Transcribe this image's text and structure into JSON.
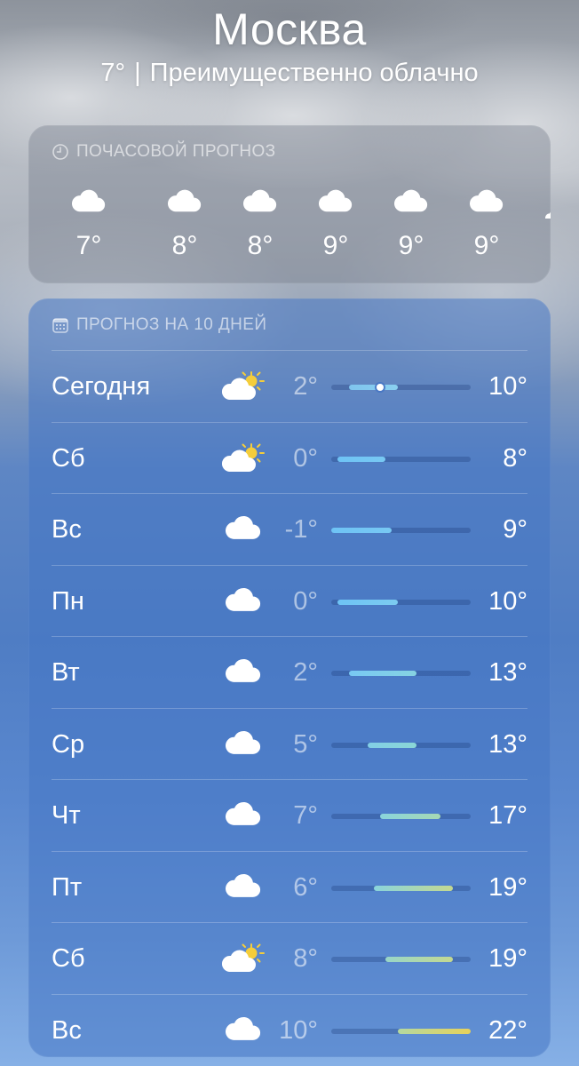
{
  "header": {
    "city": "Москва",
    "current_temp": "7°",
    "separator": "|",
    "condition": "Преимущественно облачно"
  },
  "hourly": {
    "title": "ПОЧАСОВОЙ ПРОГНОЗ",
    "icon": "clock-icon",
    "items": [
      {
        "icon": "cloud-icon",
        "temp": "7°"
      },
      {
        "icon": "cloud-icon",
        "temp": "8°"
      },
      {
        "icon": "cloud-icon",
        "temp": "8°"
      },
      {
        "icon": "cloud-icon",
        "temp": "9°"
      },
      {
        "icon": "cloud-icon",
        "temp": "9°"
      },
      {
        "icon": "cloud-icon",
        "temp": "9°"
      }
    ]
  },
  "daily": {
    "title": "ПРОГНОЗ НА 10 ДНЕЙ",
    "icon": "calendar-icon",
    "range": {
      "min": -1,
      "max": 22
    },
    "days": [
      {
        "day": "Сегодня",
        "icon": "partly-sunny-icon",
        "low": "2°",
        "high": "10°",
        "low_value": 2,
        "high_value": 10,
        "current_value": 7,
        "colors": [
          "#7fc4ee",
          "#8ad0f0"
        ]
      },
      {
        "day": "Сб",
        "icon": "partly-sunny-icon",
        "low": "0°",
        "high": "8°",
        "low_value": 0,
        "high_value": 8,
        "colors": [
          "#6ec3f5",
          "#78c8f3"
        ]
      },
      {
        "day": "Вс",
        "icon": "cloud-icon",
        "low": "-1°",
        "high": "9°",
        "low_value": -1,
        "high_value": 9,
        "colors": [
          "#6ec3f5",
          "#78c8f3"
        ]
      },
      {
        "day": "Пн",
        "icon": "cloud-icon",
        "low": "0°",
        "high": "10°",
        "low_value": 0,
        "high_value": 10,
        "colors": [
          "#6ec3f5",
          "#7ccbf0"
        ]
      },
      {
        "day": "Вт",
        "icon": "cloud-icon",
        "low": "2°",
        "high": "13°",
        "low_value": 2,
        "high_value": 13,
        "colors": [
          "#78c8f3",
          "#86d3e2"
        ]
      },
      {
        "day": "Ср",
        "icon": "cloud-icon",
        "low": "5°",
        "high": "13°",
        "low_value": 5,
        "high_value": 13,
        "colors": [
          "#82cfe6",
          "#8ad6d6"
        ]
      },
      {
        "day": "Чт",
        "icon": "cloud-icon",
        "low": "7°",
        "high": "17°",
        "low_value": 7,
        "high_value": 17,
        "colors": [
          "#8ad4dc",
          "#a6d8b4"
        ]
      },
      {
        "day": "Пт",
        "icon": "cloud-icon",
        "low": "6°",
        "high": "19°",
        "low_value": 6,
        "high_value": 19,
        "colors": [
          "#8ad4dc",
          "#c4d890"
        ]
      },
      {
        "day": "Сб",
        "icon": "partly-sunny-icon",
        "low": "8°",
        "high": "19°",
        "low_value": 8,
        "high_value": 19,
        "colors": [
          "#98d6c8",
          "#c4d890"
        ]
      },
      {
        "day": "Вс",
        "icon": "cloud-icon",
        "low": "10°",
        "high": "22°",
        "low_value": 10,
        "high_value": 22,
        "colors": [
          "#b4d8a0",
          "#e8d25a"
        ]
      }
    ]
  }
}
